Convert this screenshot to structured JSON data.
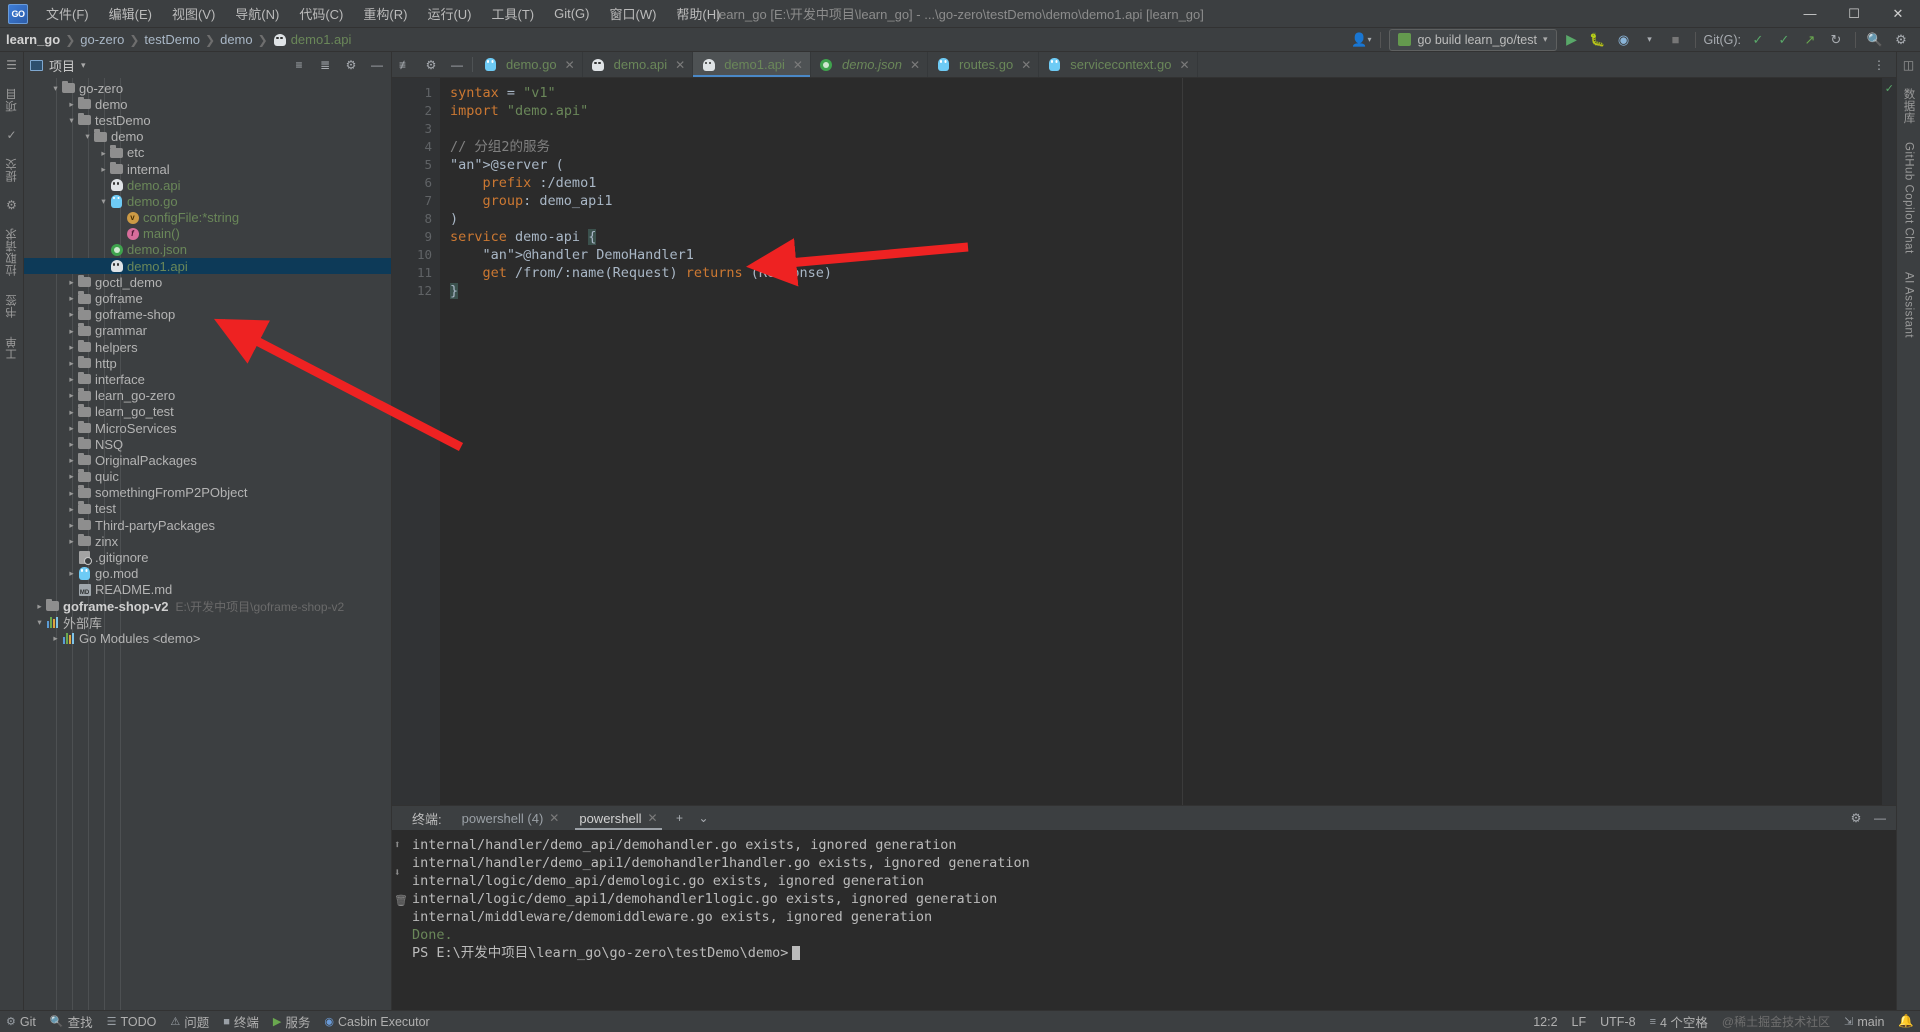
{
  "window": {
    "logo": "GO",
    "title": "learn_go [E:\\开发中项目\\learn_go] - ...\\go-zero\\testDemo\\demo\\demo1.api [learn_go]",
    "minimize": "—",
    "maximize": "☐",
    "close": "✕"
  },
  "menu": [
    {
      "label": "文件(F)",
      "name": "menu-file"
    },
    {
      "label": "编辑(E)",
      "name": "menu-edit"
    },
    {
      "label": "视图(V)",
      "name": "menu-view"
    },
    {
      "label": "导航(N)",
      "name": "menu-navigate"
    },
    {
      "label": "代码(C)",
      "name": "menu-code"
    },
    {
      "label": "重构(R)",
      "name": "menu-refactor"
    },
    {
      "label": "运行(U)",
      "name": "menu-run"
    },
    {
      "label": "工具(T)",
      "name": "menu-tools"
    },
    {
      "label": "Git(G)",
      "name": "menu-git"
    },
    {
      "label": "窗口(W)",
      "name": "menu-window"
    },
    {
      "label": "帮助(H)",
      "name": "menu-help"
    }
  ],
  "breadcrumb": [
    {
      "label": "learn_go",
      "style": "bold"
    },
    {
      "label": "go-zero",
      "style": "plain"
    },
    {
      "label": "testDemo",
      "style": "plain"
    },
    {
      "label": "demo",
      "style": "plain"
    },
    {
      "label": "demo1.api",
      "style": "file"
    }
  ],
  "toolbar": {
    "run_config": "go build learn_go/test",
    "run_tooltip": "▶",
    "git_label": "Git(G):",
    "dropdown_caret": "▾"
  },
  "project_panel": {
    "title": "项目",
    "tree": [
      {
        "indent": 1,
        "arrow": "v",
        "icon": "folder",
        "label": "go-zero",
        "style": "plain"
      },
      {
        "indent": 2,
        "arrow": ">",
        "icon": "folder",
        "label": "demo",
        "style": "plain"
      },
      {
        "indent": 2,
        "arrow": "v",
        "icon": "folder",
        "label": "testDemo",
        "style": "plain"
      },
      {
        "indent": 3,
        "arrow": "v",
        "icon": "folder",
        "label": "demo",
        "style": "plain"
      },
      {
        "indent": 4,
        "arrow": ">",
        "icon": "folder",
        "label": "etc",
        "style": "plain"
      },
      {
        "indent": 4,
        "arrow": ">",
        "icon": "folder",
        "label": "internal",
        "style": "plain"
      },
      {
        "indent": 4,
        "arrow": "",
        "icon": "api",
        "label": "demo.api",
        "style": "green"
      },
      {
        "indent": 4,
        "arrow": "v",
        "icon": "gopher",
        "label": "demo.go",
        "style": "green"
      },
      {
        "indent": 5,
        "arrow": "",
        "icon": "var",
        "label": "configFile:*string",
        "style": "green"
      },
      {
        "indent": 5,
        "arrow": "",
        "icon": "func",
        "label": "main()",
        "style": "green"
      },
      {
        "indent": 4,
        "arrow": "",
        "icon": "json",
        "label": "demo.json",
        "style": "green"
      },
      {
        "indent": 4,
        "arrow": "",
        "icon": "api",
        "label": "demo1.api",
        "style": "green",
        "selected": true
      },
      {
        "indent": 2,
        "arrow": ">",
        "icon": "folder",
        "label": "goctl_demo",
        "style": "plain"
      },
      {
        "indent": 2,
        "arrow": ">",
        "icon": "folder",
        "label": "goframe",
        "style": "plain"
      },
      {
        "indent": 2,
        "arrow": ">",
        "icon": "folder",
        "label": "goframe-shop",
        "style": "plain"
      },
      {
        "indent": 2,
        "arrow": ">",
        "icon": "folder",
        "label": "grammar",
        "style": "plain"
      },
      {
        "indent": 2,
        "arrow": ">",
        "icon": "folder",
        "label": "helpers",
        "style": "plain"
      },
      {
        "indent": 2,
        "arrow": ">",
        "icon": "folder",
        "label": "http",
        "style": "plain"
      },
      {
        "indent": 2,
        "arrow": ">",
        "icon": "folder",
        "label": "interface",
        "style": "plain"
      },
      {
        "indent": 2,
        "arrow": ">",
        "icon": "folder",
        "label": "learn_go-zero",
        "style": "plain"
      },
      {
        "indent": 2,
        "arrow": ">",
        "icon": "folder",
        "label": "learn_go_test",
        "style": "plain"
      },
      {
        "indent": 2,
        "arrow": ">",
        "icon": "folder",
        "label": "MicroServices",
        "style": "plain"
      },
      {
        "indent": 2,
        "arrow": ">",
        "icon": "folder",
        "label": "NSQ",
        "style": "plain"
      },
      {
        "indent": 2,
        "arrow": ">",
        "icon": "folder",
        "label": "OriginalPackages",
        "style": "plain"
      },
      {
        "indent": 2,
        "arrow": ">",
        "icon": "folder",
        "label": "quic",
        "style": "plain"
      },
      {
        "indent": 2,
        "arrow": ">",
        "icon": "folder",
        "label": "somethingFromP2PObject",
        "style": "plain"
      },
      {
        "indent": 2,
        "arrow": ">",
        "icon": "folder",
        "label": "test",
        "style": "plain"
      },
      {
        "indent": 2,
        "arrow": ">",
        "icon": "folder",
        "label": "Third-partyPackages",
        "style": "plain"
      },
      {
        "indent": 2,
        "arrow": ">",
        "icon": "folder",
        "label": "zinx",
        "style": "plain"
      },
      {
        "indent": 2,
        "arrow": "",
        "icon": "gitignore",
        "label": ".gitignore",
        "style": "plain"
      },
      {
        "indent": 2,
        "arrow": ">",
        "icon": "gopher",
        "label": "go.mod",
        "style": "plain"
      },
      {
        "indent": 2,
        "arrow": "",
        "icon": "md",
        "label": "README.md",
        "style": "plain"
      },
      {
        "indent": 0,
        "arrow": ">",
        "icon": "folder",
        "label": "goframe-shop-v2",
        "style": "bold",
        "sub": "E:\\开发中项目\\goframe-shop-v2"
      },
      {
        "indent": 0,
        "arrow": "v",
        "icon": "lib",
        "label": "外部库",
        "style": "plain"
      },
      {
        "indent": 1,
        "arrow": ">",
        "icon": "lib",
        "label": "Go Modules <demo>",
        "style": "plain"
      }
    ]
  },
  "left_strip": [
    {
      "label": "项目",
      "name": "tool-window-project"
    },
    {
      "label": "提交",
      "name": "tool-window-commit"
    },
    {
      "label": "拉取请求",
      "name": "tool-window-pull-requests"
    },
    {
      "label": "书签",
      "name": "tool-window-bookmarks"
    },
    {
      "label": "工单",
      "name": "tool-window-issues"
    }
  ],
  "right_strip": [
    {
      "label": "数据库",
      "name": "tool-window-database"
    },
    {
      "label": "GitHub Copilot Chat",
      "name": "tool-window-copilot-chat"
    },
    {
      "label": "AI Assistant",
      "name": "tool-window-ai-assistant"
    }
  ],
  "editor_tabs": [
    {
      "label": "demo.go",
      "icon": "gopher",
      "active": false,
      "italic": false
    },
    {
      "label": "demo.api",
      "icon": "api",
      "active": false,
      "italic": false
    },
    {
      "label": "demo1.api",
      "icon": "api",
      "active": true,
      "italic": false
    },
    {
      "label": "demo.json",
      "icon": "json",
      "active": false,
      "italic": true
    },
    {
      "label": "routes.go",
      "icon": "gopher",
      "active": false,
      "italic": false
    },
    {
      "label": "servicecontext.go",
      "icon": "gopher",
      "active": false,
      "italic": false
    }
  ],
  "code": {
    "lines": [
      "1",
      "2",
      "3",
      "4",
      "5",
      "6",
      "7",
      "8",
      "9",
      "10",
      "11",
      "12"
    ],
    "text_lines": [
      "syntax = \"v1\"",
      "import \"demo.api\"",
      "",
      "// 分组2的服务",
      "@server (",
      "    prefix :/demo1",
      "    group: demo_api1",
      ")",
      "service demo-api {",
      "    @handler DemoHandler1",
      "    get /from/:name(Request) returns (Response)",
      "}"
    ]
  },
  "terminal": {
    "label": "终端:",
    "tabs": [
      {
        "label": "powershell (4)",
        "active": false
      },
      {
        "label": "powershell",
        "active": true
      }
    ],
    "add": "+",
    "chevron": "⌄",
    "lines": [
      {
        "text": "internal/handler/demo_api/demohandler.go exists, ignored generation",
        "style": "plain"
      },
      {
        "text": "internal/handler/demo_api1/demohandler1handler.go exists, ignored generation",
        "style": "plain"
      },
      {
        "text": "internal/logic/demo_api/demologic.go exists, ignored generation",
        "style": "plain"
      },
      {
        "text": "internal/logic/demo_api1/demohandler1logic.go exists, ignored generation",
        "style": "plain"
      },
      {
        "text": "internal/middleware/demomiddleware.go exists, ignored generation",
        "style": "plain"
      },
      {
        "text": "Done.",
        "style": "done"
      },
      {
        "text": "PS E:\\开发中项目\\learn_go\\go-zero\\testDemo\\demo>",
        "style": "prompt"
      }
    ]
  },
  "statusbar": {
    "left": [
      {
        "label": "Git",
        "name": "status-git"
      },
      {
        "label": "查找",
        "name": "status-find"
      },
      {
        "label": "TODO",
        "name": "status-todo"
      },
      {
        "label": "问题",
        "name": "status-problems"
      },
      {
        "label": "终端",
        "name": "status-terminal"
      },
      {
        "label": "服务",
        "name": "status-services"
      },
      {
        "label": "Casbin Executor",
        "name": "status-casbin-executor"
      }
    ],
    "right": [
      {
        "label": "12:2",
        "name": "status-caret-position"
      },
      {
        "label": "LF",
        "name": "status-line-separator"
      },
      {
        "label": "UTF-8",
        "name": "status-encoding"
      },
      {
        "label": "4 个空格",
        "name": "status-indent"
      },
      {
        "label": "main",
        "name": "status-branch"
      }
    ],
    "watermark": "@稀土掘金技术社区"
  },
  "colors": {
    "accent": "#4a88c7",
    "selection": "#0d3a58",
    "string": "#6a8759",
    "keyword": "#cc7832",
    "annotation": "#bbb529",
    "comment": "#808080",
    "arrow": "#ee2222"
  }
}
